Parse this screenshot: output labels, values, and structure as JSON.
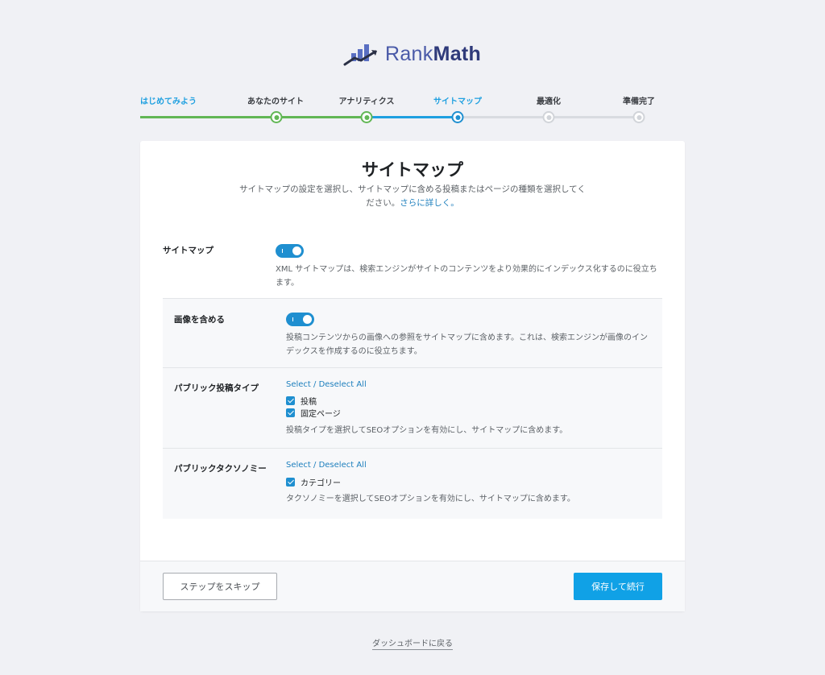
{
  "brand": {
    "name_regular": "Rank",
    "name_bold": "Math"
  },
  "steps": [
    {
      "label": "はじめてみよう",
      "state": "done"
    },
    {
      "label": "あなたのサイト",
      "state": "done"
    },
    {
      "label": "アナリティクス",
      "state": "done"
    },
    {
      "label": "サイトマップ",
      "state": "current"
    },
    {
      "label": "最適化",
      "state": "pending"
    },
    {
      "label": "準備完了",
      "state": "pending"
    }
  ],
  "card": {
    "title": "サイトマップ",
    "description": "サイトマップの設定を選択し、サイトマップに含める投稿またはページの種類を選択してください。",
    "learn_more": "さらに詳しく。"
  },
  "sitemap": {
    "label": "サイトマップ",
    "enabled": true,
    "desc_line1": "XML サイトマップは、検索エンジンがサイトのコンテンツをより効果的にインデックス化するのに役立ち",
    "desc_line2": "ます。"
  },
  "include_images": {
    "label": "画像を含める",
    "enabled": true,
    "desc_line1": "投稿コンテンツからの画像への参照をサイトマップに含めます。これは、検索エンジンが画像のイン",
    "desc_line2": "デックスを作成するのに役立ちます。"
  },
  "post_types": {
    "label": "パブリック投稿タイプ",
    "select_all": "Select / Deselect All",
    "options": [
      {
        "label": "投稿",
        "checked": true
      },
      {
        "label": "固定ページ",
        "checked": true
      }
    ],
    "desc": "投稿タイプを選択してSEOオプションを有効にし、サイトマップに含めます。"
  },
  "taxonomies": {
    "label": "パブリックタクソノミー",
    "select_all": "Select / Deselect All",
    "options": [
      {
        "label": "カテゴリー",
        "checked": true
      }
    ],
    "desc": "タクソノミーを選択してSEOオプションを有効にし、サイトマップに含めます。"
  },
  "footer": {
    "skip_label": "ステップをスキップ",
    "save_label": "保存して続行"
  },
  "back_link": "ダッシュボードに戻る",
  "colors": {
    "accent": "#1fa0e0",
    "done": "#62b755",
    "pending": "#d1d4d9",
    "primary_button": "#10a1e6"
  }
}
